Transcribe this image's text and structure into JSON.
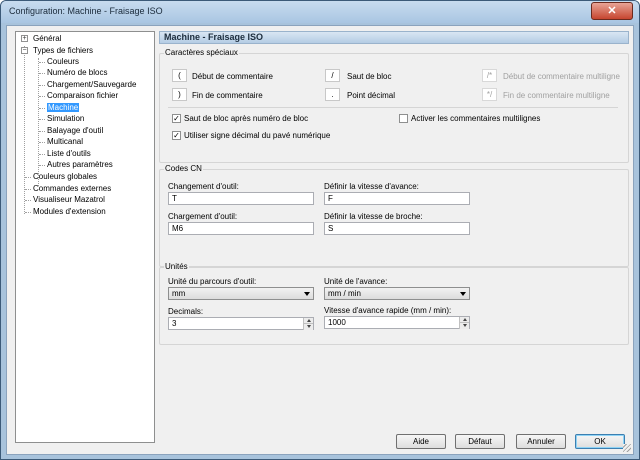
{
  "window": {
    "title": "Configuration: Machine - Fraisage ISO",
    "close_glyph": "✕"
  },
  "tree": {
    "items": [
      {
        "label": "Général",
        "expander": "+"
      },
      {
        "label": "Types de fichiers",
        "expander": "−"
      },
      {
        "label": "Couleurs"
      },
      {
        "label": "Numéro de blocs"
      },
      {
        "label": "Chargement/Sauvegarde"
      },
      {
        "label": "Comparaison fichier"
      },
      {
        "label": "Machine",
        "selected": true
      },
      {
        "label": "Simulation"
      },
      {
        "label": "Balayage d'outil"
      },
      {
        "label": "Multicanal"
      },
      {
        "label": "Liste d'outils"
      },
      {
        "label": "Autres paramètres"
      },
      {
        "label": "Couleurs globales"
      },
      {
        "label": "Commandes externes"
      },
      {
        "label": "Visualiseur Mazatrol"
      },
      {
        "label": "Modules d'extension"
      }
    ]
  },
  "panel": {
    "header": "Machine - Fraisage ISO"
  },
  "special_chars": {
    "title": "Caractères spéciaux",
    "items": [
      {
        "key": "(",
        "label": "Début de commentaire",
        "enabled": true
      },
      {
        "key": "/",
        "label": "Saut de bloc",
        "enabled": true
      },
      {
        "key": "/*",
        "label": "Début de commentaire multiligne",
        "enabled": false
      },
      {
        "key": ")",
        "label": "Fin de commentaire",
        "enabled": true
      },
      {
        "key": ".",
        "label": "Point décimal",
        "enabled": true
      },
      {
        "key": "*/",
        "label": "Fin de commentaire multiligne",
        "enabled": false
      }
    ],
    "checkboxes": [
      {
        "label": "Saut de bloc après numéro de bloc",
        "checked": true
      },
      {
        "label": "Activer les commentaires multilignes",
        "checked": false
      },
      {
        "label": "Utiliser signe décimal du pavé numérique",
        "checked": true
      }
    ],
    "check_glyph": "✓"
  },
  "nc_codes": {
    "title": "Codes CN",
    "fields": [
      {
        "label": "Changement d'outil:",
        "value": "T"
      },
      {
        "label": "Définir la vitesse d'avance:",
        "value": "F"
      },
      {
        "label": "Chargement d'outil:",
        "value": "M6"
      },
      {
        "label": "Définir la vitesse de broche:",
        "value": "S"
      }
    ]
  },
  "units": {
    "title": "Unités",
    "tool_path_unit": {
      "label": "Unité du parcours d'outil:",
      "value": "mm"
    },
    "feed_unit": {
      "label": "Unité de l'avance:",
      "value": "mm / min"
    },
    "decimals": {
      "label": "Decimals:",
      "value": "3"
    },
    "rapid_feed": {
      "label": "Vitesse d'avance rapide (mm / min):",
      "value": "1000"
    }
  },
  "buttons": {
    "help": "Aide",
    "default": "Défaut",
    "cancel": "Annuler",
    "ok": "OK"
  }
}
